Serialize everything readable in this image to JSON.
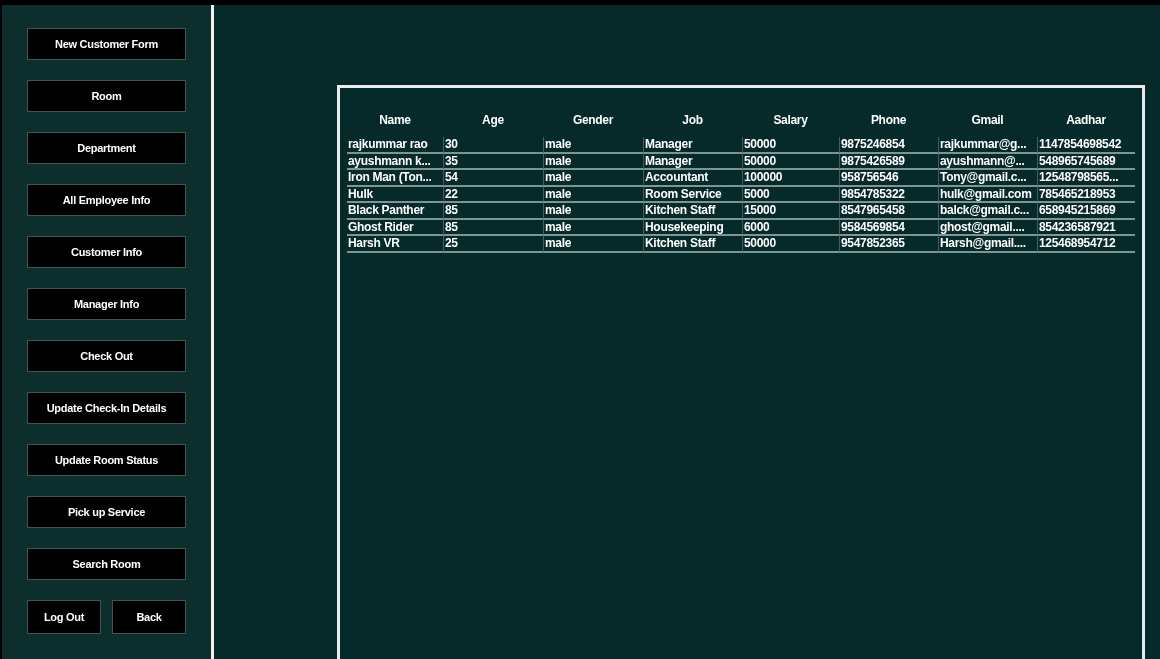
{
  "sidebar": {
    "buttons": [
      "New Customer Form",
      "Room",
      "Department",
      "All Employee Info",
      "Customer Info",
      "Manager Info",
      "Check Out",
      "Update Check-In Details",
      "Update Room Status",
      "Pick up Service",
      "Search Room"
    ],
    "bottom_buttons": [
      "Log Out",
      "Back"
    ]
  },
  "table": {
    "columns": [
      "Name",
      "Age",
      "Gender",
      "Job",
      "Salary",
      "Phone",
      "Gmail",
      "Aadhar"
    ],
    "rows": [
      [
        "rajkummar rao",
        "30",
        "male",
        "Manager",
        "50000",
        "9875246854",
        "rajkummar@g...",
        "1147854698542"
      ],
      [
        "ayushmann k...",
        "35",
        "male",
        "Manager",
        "50000",
        "9875426589",
        "ayushmann@...",
        "548965745689"
      ],
      [
        "Iron Man (Ton...",
        "54",
        "male",
        "Accountant",
        "100000",
        "958756546",
        "Tony@gmail.c...",
        "12548798565..."
      ],
      [
        "Hulk",
        "22",
        "male",
        "Room Service",
        "5000",
        "9854785322",
        "hulk@gmail.com",
        "785465218953"
      ],
      [
        "Black Panther",
        "85",
        "male",
        "Kitchen Staff",
        "15000",
        "8547965458",
        "balck@gmail.c...",
        "658945215869"
      ],
      [
        "Ghost Rider",
        "85",
        "male",
        "Housekeeping",
        "6000",
        "9584569854",
        "ghost@gmail....",
        "854236587921"
      ],
      [
        "Harsh VR",
        "25",
        "male",
        "Kitchen Staff",
        "50000",
        "9547852365",
        "Harsh@gmail....",
        "125468954712"
      ]
    ]
  }
}
